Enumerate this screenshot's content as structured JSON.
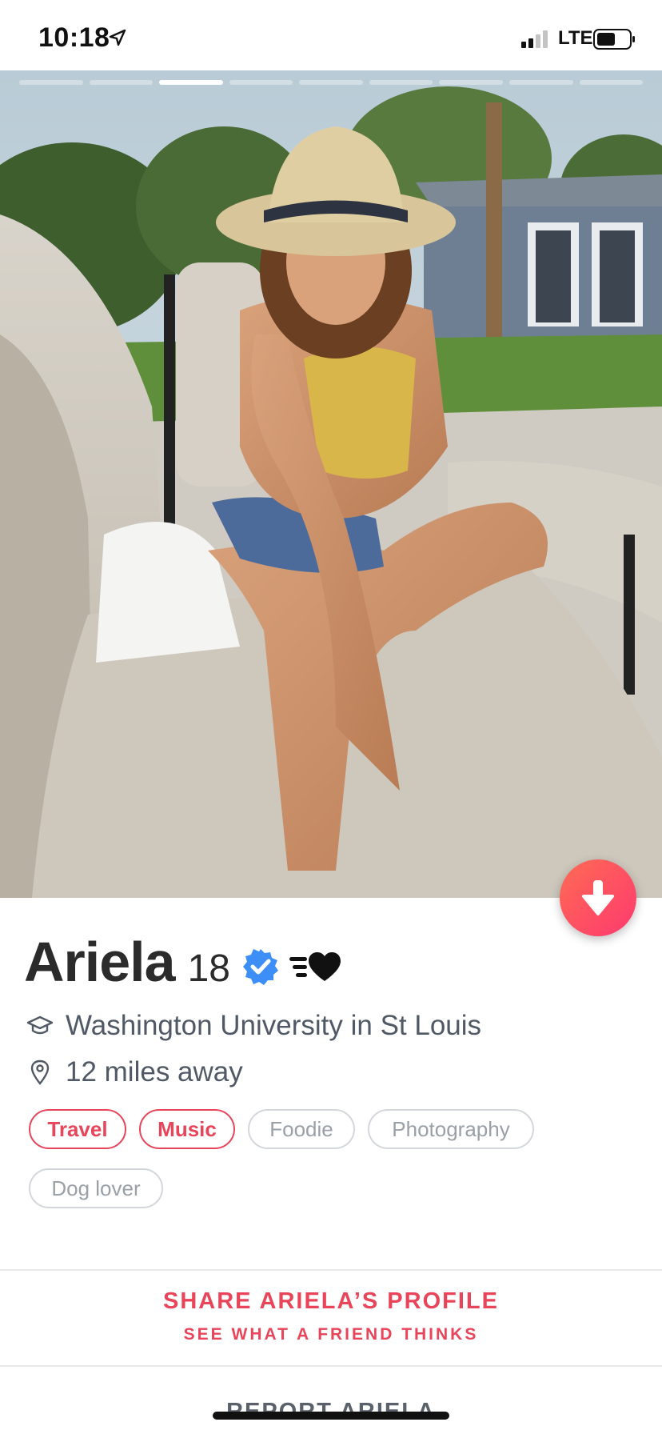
{
  "status_bar": {
    "time": "10:18",
    "network": "LTE",
    "icons": [
      "location-arrow-icon",
      "signal-bars-icon",
      "battery-icon"
    ]
  },
  "photo": {
    "photo_count": 9,
    "active_index": 2,
    "description_icon": "profile-photo"
  },
  "profile": {
    "name": "Ariela",
    "age": "18",
    "verified_icon": "verified-badge-icon",
    "vibe_icon": "swipe-surge-heart-icon",
    "school": "Washington University in St Louis",
    "distance": "12 miles away",
    "interests": [
      {
        "label": "Travel",
        "shared": true
      },
      {
        "label": "Music",
        "shared": true
      },
      {
        "label": "Foodie",
        "shared": false
      },
      {
        "label": "Photography",
        "shared": false
      },
      {
        "label": "Dog lover",
        "shared": false
      }
    ]
  },
  "share": {
    "title": "SHARE ARIELA’S PROFILE",
    "subtitle": "SEE WHAT A FRIEND THINKS"
  },
  "report": {
    "label": "REPORT ARIELA"
  },
  "colors": {
    "accent": "#e8455b",
    "gradient_start": "#ff6b54",
    "gradient_end": "#fd3a6f",
    "verified_blue": "#3e8ef7"
  }
}
